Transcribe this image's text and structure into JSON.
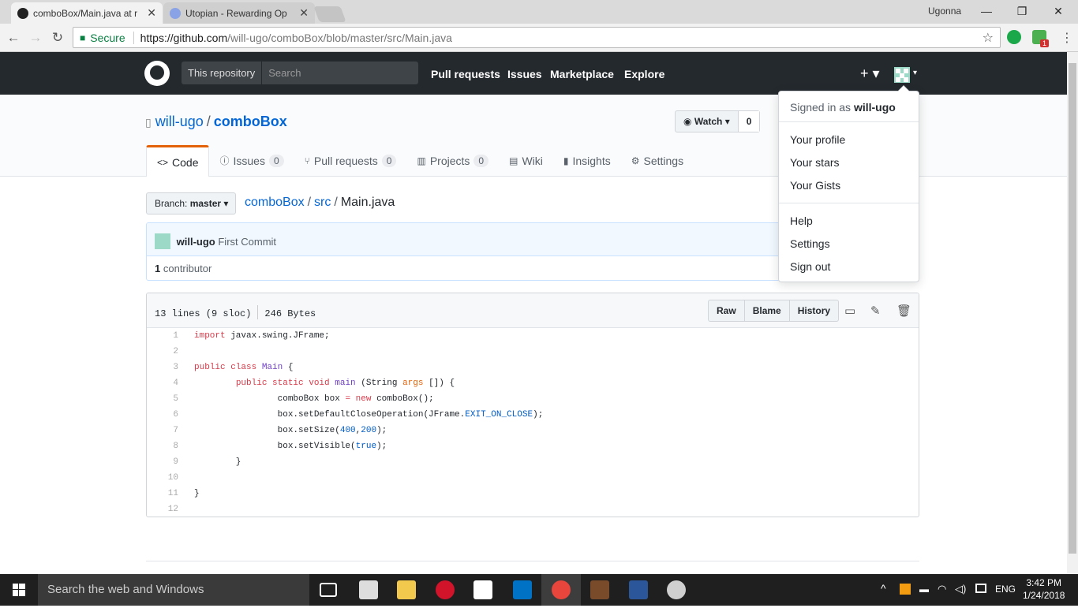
{
  "browser": {
    "tabs": [
      {
        "title": "comboBox/Main.java at r",
        "active": true
      },
      {
        "title": "Utopian - Rewarding Op",
        "active": false
      }
    ],
    "user": "Ugonna",
    "secure_label": "Secure",
    "url_host": "https://github.com",
    "url_path": "/will-ugo/comboBox/blob/master/src/Main.java",
    "ext_badge": "1"
  },
  "github": {
    "scope": "This repository",
    "search_placeholder": "Search",
    "nav": [
      "Pull requests",
      "Issues",
      "Marketplace",
      "Explore"
    ],
    "plus": "+ ▾"
  },
  "repo": {
    "owner": "will-ugo",
    "name": "comboBox",
    "watch_label": "Watch",
    "watch_count": "0",
    "tabs": [
      {
        "label": "Code",
        "icon": "<>",
        "count": null
      },
      {
        "label": "Issues",
        "icon": "ⓘ",
        "count": "0"
      },
      {
        "label": "Pull requests",
        "icon": "⑂",
        "count": "0"
      },
      {
        "label": "Projects",
        "icon": "▥",
        "count": "0"
      },
      {
        "label": "Wiki",
        "icon": "▤",
        "count": null
      },
      {
        "label": "Insights",
        "icon": "▮",
        "count": null
      },
      {
        "label": "Settings",
        "icon": "⚙",
        "count": null
      }
    ]
  },
  "file": {
    "branch_prefix": "Branch:",
    "branch": "master",
    "crumb_repo": "comboBox",
    "crumb_dir": "src",
    "crumb_file": "Main.java",
    "commit_author": "will-ugo",
    "commit_message": "First Commit",
    "contributors_count": "1",
    "contributors_label": "contributor",
    "lines_info": "13 lines (9 sloc)",
    "size_info": "246 Bytes",
    "buttons": [
      "Raw",
      "Blame",
      "History"
    ]
  },
  "code_lines": [
    "1",
    "2",
    "3",
    "4",
    "5",
    "6",
    "7",
    "8",
    "9",
    "10",
    "11",
    "12"
  ],
  "dropdown": {
    "signed_in_prefix": "Signed in as",
    "username": "will-ugo",
    "items_a": [
      "Your profile",
      "Your stars",
      "Your Gists"
    ],
    "items_b": [
      "Help",
      "Settings",
      "Sign out"
    ]
  },
  "taskbar": {
    "search_placeholder": "Search the web and Windows",
    "lang": "ENG",
    "time": "3:42 PM",
    "date": "1/24/2018"
  },
  "colors": {
    "header_bg": "#24292e",
    "link": "#0366d6",
    "active_tab_accent": "#e36209",
    "taskbar_bg": "#1f1f1f"
  }
}
